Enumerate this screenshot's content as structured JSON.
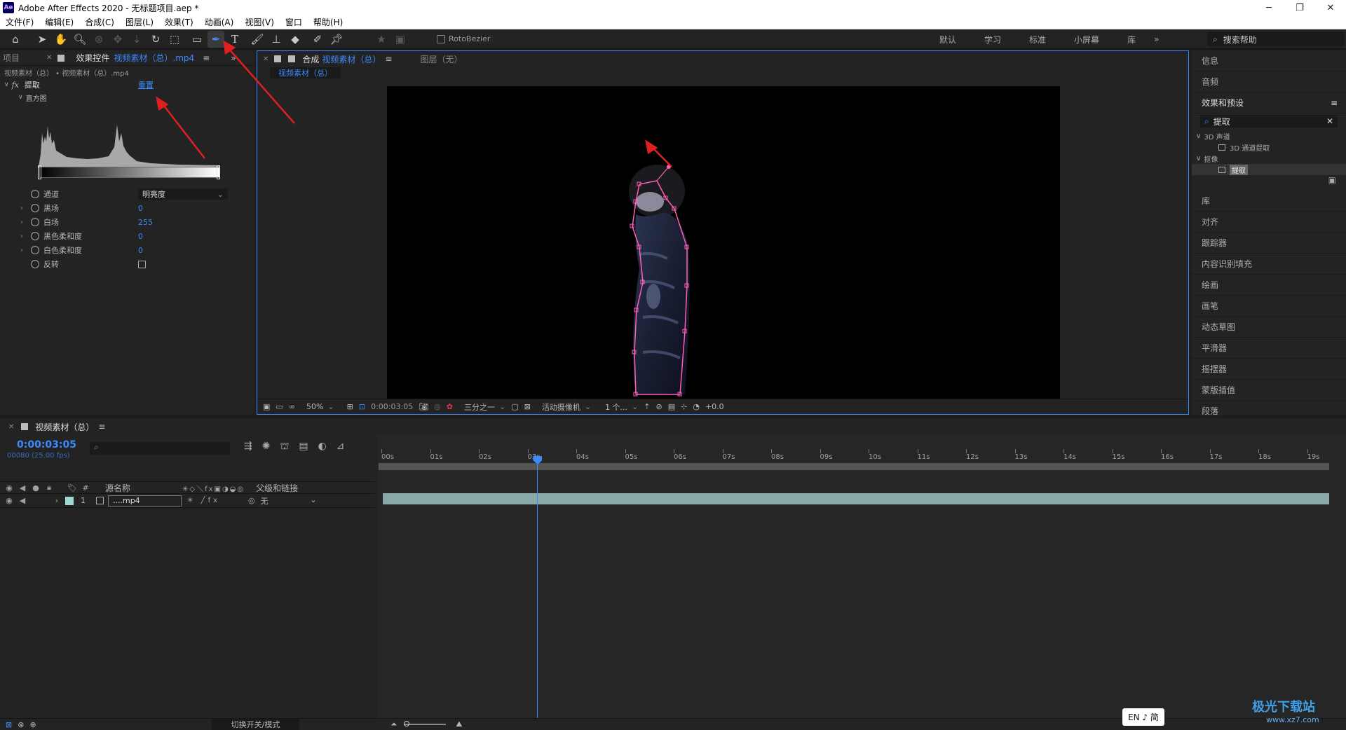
{
  "window": {
    "title": "Adobe After Effects 2020 - 无标题项目.aep *",
    "app_icon": "Ae"
  },
  "menu": [
    "文件(F)",
    "编辑(E)",
    "合成(C)",
    "图层(L)",
    "效果(T)",
    "动画(A)",
    "视图(V)",
    "窗口",
    "帮助(H)"
  ],
  "toolbar": {
    "rotobezier": "RotoBezier"
  },
  "workspaces": [
    "默认",
    "学习",
    "标准",
    "小屏幕",
    "库"
  ],
  "search_help": "搜索帮助",
  "effect_controls": {
    "project_tab": "项目",
    "tab_label": "效果控件",
    "tab_source": "视频素材（总）.mp4",
    "breadcrumb": "视频素材（总） • 视频素材（总）.mp4",
    "effect_name": "提取",
    "reset_label": "重置",
    "histogram_label": "直方图",
    "properties": [
      {
        "label": "通道",
        "value": "明亮度",
        "type": "dropdown"
      },
      {
        "label": "黑场",
        "value": "0"
      },
      {
        "label": "白场",
        "value": "255"
      },
      {
        "label": "黑色柔和度",
        "value": "0"
      },
      {
        "label": "白色柔和度",
        "value": "0"
      },
      {
        "label": "反转",
        "value": "",
        "type": "checkbox"
      }
    ]
  },
  "composition": {
    "tab_prefix": "合成",
    "tab_name": "视频素材（总）",
    "layer_tab": "图层（无）",
    "sub_tab": "视频素材（总）",
    "footer": {
      "zoom": "50%",
      "timecode": "0:00:03:05",
      "resolution": "三分之一",
      "camera": "活动摄像机",
      "views": "1 个...",
      "exposure": "+0.0"
    }
  },
  "right_panels": {
    "items_top": [
      "信息",
      "音频",
      "效果和预设"
    ],
    "search_value": "提取",
    "tree": [
      {
        "label": "3D 声道",
        "level": 0
      },
      {
        "label": "3D 通道提取",
        "level": 1
      },
      {
        "label": "抠像",
        "level": 0
      },
      {
        "label": "提取",
        "level": 1,
        "selected": true
      }
    ],
    "items_bottom": [
      "库",
      "对齐",
      "跟踪器",
      "内容识别填充",
      "绘画",
      "画笔",
      "动态草图",
      "平滑器",
      "摇摆器",
      "蒙版插值",
      "段落"
    ]
  },
  "timeline": {
    "tab_label": "视频素材（总）",
    "timecode": "0:00:03:05",
    "fps": "00080 (25.00 fps)",
    "col_source": "源名称",
    "col_parent": "父级和链接",
    "layer": {
      "index": "1",
      "name": "....mp4",
      "parent": "无"
    },
    "ruler": [
      "00s",
      "01s",
      "02s",
      "03s",
      "04s",
      "05s",
      "06s",
      "07s",
      "08s",
      "09s",
      "10s",
      "11s",
      "12s",
      "13s",
      "14s",
      "15s",
      "16s",
      "17s",
      "18s",
      "19s"
    ],
    "playhead_seconds": 3.2,
    "footer_toggle": "切换开关/模式"
  },
  "ime": "EN ♪ 简",
  "watermark": {
    "main": "极光下载站",
    "sub": "www.xz7.com"
  },
  "accent_color": "#3b8bff"
}
